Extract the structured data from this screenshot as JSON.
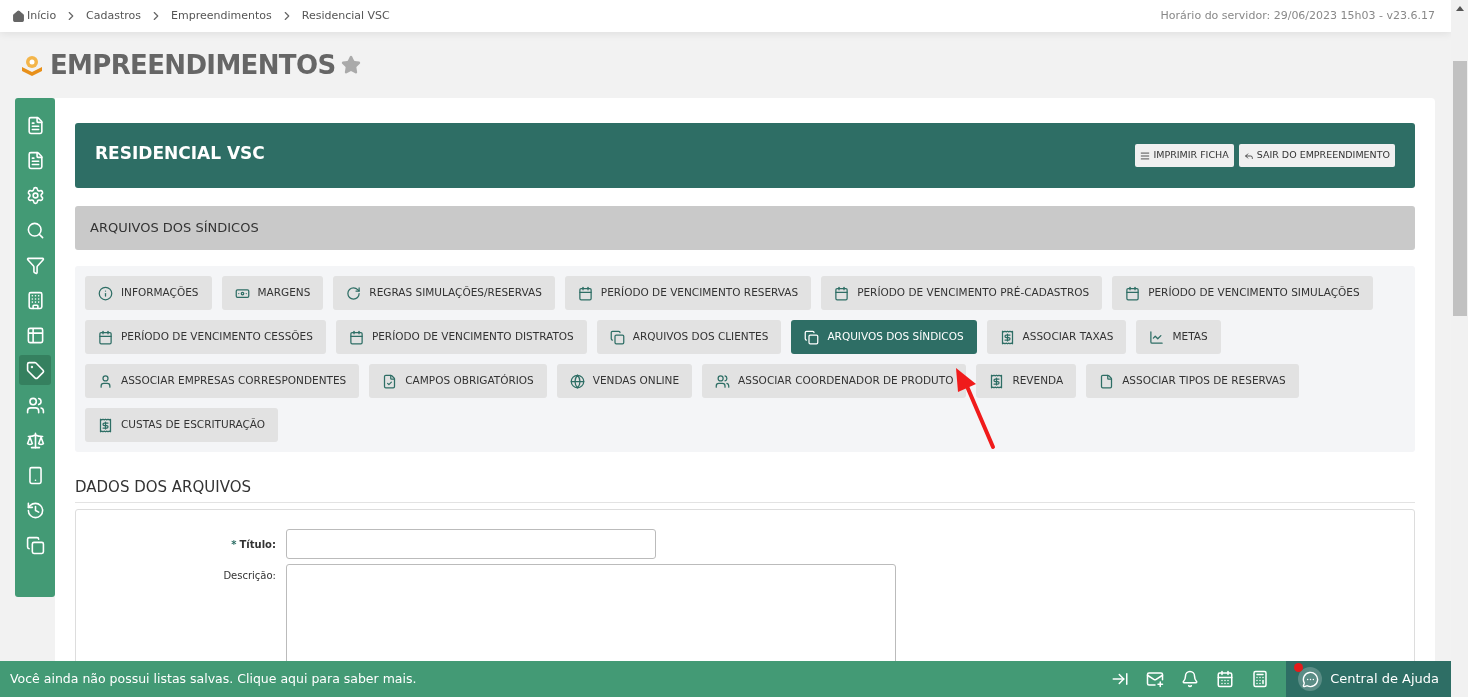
{
  "breadcrumb": [
    "Início",
    "Cadastros",
    "Empreendimentos",
    "Residencial VSC"
  ],
  "server_time": "Horário do servidor: 29/06/2023 15h03 - v23.6.17",
  "page_title": "EMPREENDIMENTOS",
  "favorite": false,
  "sidebar": {
    "items": [
      {
        "selected": false
      },
      {
        "selected": false
      },
      {
        "selected": false
      },
      {
        "selected": false
      },
      {
        "selected": false
      },
      {
        "selected": false
      },
      {
        "selected": false
      },
      {
        "selected": true
      },
      {
        "selected": false
      },
      {
        "selected": false
      },
      {
        "selected": false
      },
      {
        "selected": false
      },
      {
        "selected": false
      }
    ]
  },
  "header": {
    "title": "RESIDENCIAL VSC",
    "buttons": [
      "IMPRIMIR FICHA",
      "SAIR DO EMPREENDIMENTO"
    ]
  },
  "section_bar": "ARQUIVOS DOS SÍNDICOS",
  "tabs": [
    {
      "label": "INFORMAÇÕES",
      "selected": false
    },
    {
      "label": "MARGENS",
      "selected": false
    },
    {
      "label": "REGRAS SIMULAÇÕES/RESERVAS",
      "selected": false
    },
    {
      "label": "PERÍODO DE VENCIMENTO RESERVAS",
      "selected": false
    },
    {
      "label": "PERÍODO DE VENCIMENTO PRÉ-CADASTROS",
      "selected": false
    },
    {
      "label": "PERÍODO DE VENCIMENTO SIMULAÇÕES",
      "selected": false
    },
    {
      "label": "PERÍODO DE VENCIMENTO CESSÕES",
      "selected": false
    },
    {
      "label": "PERÍODO DE VENCIMENTO DISTRATOS",
      "selected": false
    },
    {
      "label": "ARQUIVOS DOS CLIENTES",
      "selected": false
    },
    {
      "label": "ARQUIVOS DOS SÍNDICOS",
      "selected": true
    },
    {
      "label": "ASSOCIAR TAXAS",
      "selected": false
    },
    {
      "label": "METAS",
      "selected": false
    },
    {
      "label": "ASSOCIAR EMPRESAS CORRESPONDENTES",
      "selected": false
    },
    {
      "label": "CAMPOS OBRIGATÓRIOS",
      "selected": false
    },
    {
      "label": "VENDAS ONLINE",
      "selected": false
    },
    {
      "label": "ASSOCIAR COORDENADOR DE PRODUTO",
      "selected": false
    },
    {
      "label": "REVENDA",
      "selected": false
    },
    {
      "label": "ASSOCIAR TIPOS DE RESERVAS",
      "selected": false
    },
    {
      "label": "CUSTAS DE ESCRITURAÇÃO",
      "selected": false
    }
  ],
  "form": {
    "title": "DADOS DOS ARQUIVOS",
    "fields": [
      {
        "kind": "text",
        "label": "Título:",
        "required_mark": "*"
      },
      {
        "kind": "textarea",
        "label": "Descrição:"
      }
    ]
  },
  "footer": {
    "message": "Você ainda não possui listas salvas. Clique aqui para saber mais.",
    "help": "Central de Ajuda",
    "help_notification": true
  }
}
